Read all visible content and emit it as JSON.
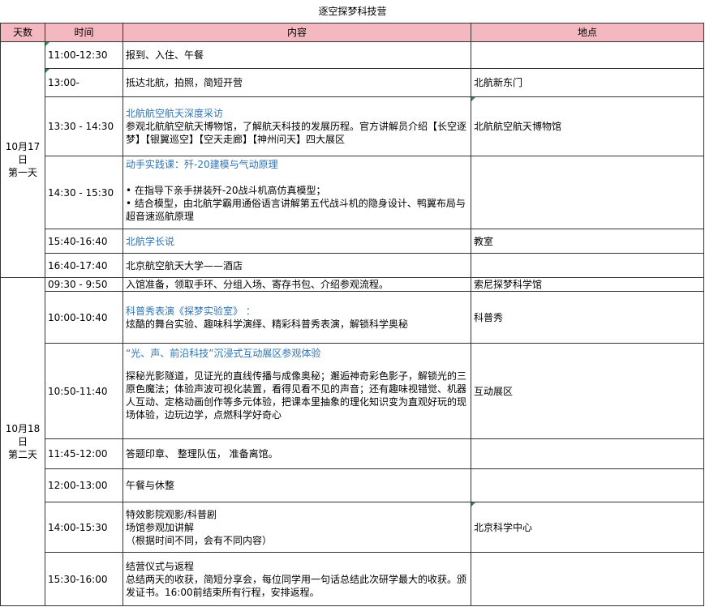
{
  "title": "逐空探梦科技营",
  "headers": {
    "day": "天数",
    "time": "时间",
    "content": "内容",
    "place": "地点"
  },
  "days": [
    {
      "label_lines": [
        "10月17",
        "日",
        "第一天"
      ]
    },
    {
      "label_lines": [
        "10月18",
        "日",
        "第二天"
      ]
    }
  ],
  "rows": [
    {
      "time": "11:00-12:30",
      "content": [
        "报到、入住、午餐"
      ],
      "place": ""
    },
    {
      "time": "13:00-",
      "content": [
        "抵达北航，拍照，简短开营"
      ],
      "place": "北航新东门"
    },
    {
      "time": "13:30 - 14:30",
      "heading": "北航航空航天深度采访",
      "content": [
        "参观北航航空航天博物馆，了解航天科技的发展历程。官方讲解员介绍【长空逐梦】【银翼巡空】【空天走廊】【神州问天】四大展区"
      ],
      "place": "北航航空航天博物馆"
    },
    {
      "time": "14:30 - 15:30",
      "heading": "动手实践课：歼-20建模与气动原理",
      "content": [
        "•  在指导下亲手拼装歼-20战斗机高仿真模型；",
        "•  结合模型，由北航学霸用通俗语言讲解第五代战斗机的隐身设计、鸭翼布局与超音速巡航原理"
      ],
      "place": ""
    },
    {
      "time": "15:40-16:40",
      "heading": "北航学长说",
      "content": [],
      "place": "教室"
    },
    {
      "time": "16:40-17:40",
      "content": [
        "北京航空航天大学——酒店"
      ],
      "place": ""
    },
    {
      "time": "09:30 - 9:50",
      "content": [
        "入馆准备，领取手环、分组入场、寄存书包、介绍参观流程。"
      ],
      "place": "索尼探梦科学馆"
    },
    {
      "time": "10:00-10:40",
      "heading": "科普秀表演《探梦实验室》 ：",
      "content": [
        "炫酷的舞台实验、趣味科学演绎、精彩科普秀表演，解锁科学奥秘"
      ],
      "place": "科普秀"
    },
    {
      "time": "10:50-11:40",
      "heading": "“光、声、前沿科技”沉浸式互动展区参观体验",
      "content": [
        "探秘光影隧道，见证光的直线传播与成像奥秘；邂逅神奇彩色影子，解锁光的三原色魔法；体验声波可视化装置，看得见看不见的声音；还有趣味视错觉、机器人互动、定格动画创作等多元体验，把课本里抽象的理化知识变为直观好玩的现场体验，边玩边学，点燃科学好奇心"
      ],
      "place": "互动展区"
    },
    {
      "time": "11:45-12:00",
      "content": [
        "答题印章、  整理队伍，  准备离馆。"
      ],
      "place": ""
    },
    {
      "time": "12:00-13:00",
      "content": [
        "午餐与休整"
      ],
      "place": ""
    },
    {
      "time": "14:00-15:30",
      "content": [
        "特效影院观影/科普剧",
        "场馆参观加讲解",
        "（根据时间不同，会有不同内容）"
      ],
      "place": "北京科学中心"
    },
    {
      "time": "15:30-16:00",
      "content": [
        "结营仪式与返程",
        "总结两天的收获，简短分享会，每位同学用一句话总结此次研学最大的收获。颁发证书。16:00前结束所有行程，安排返程。"
      ],
      "place": ""
    }
  ]
}
